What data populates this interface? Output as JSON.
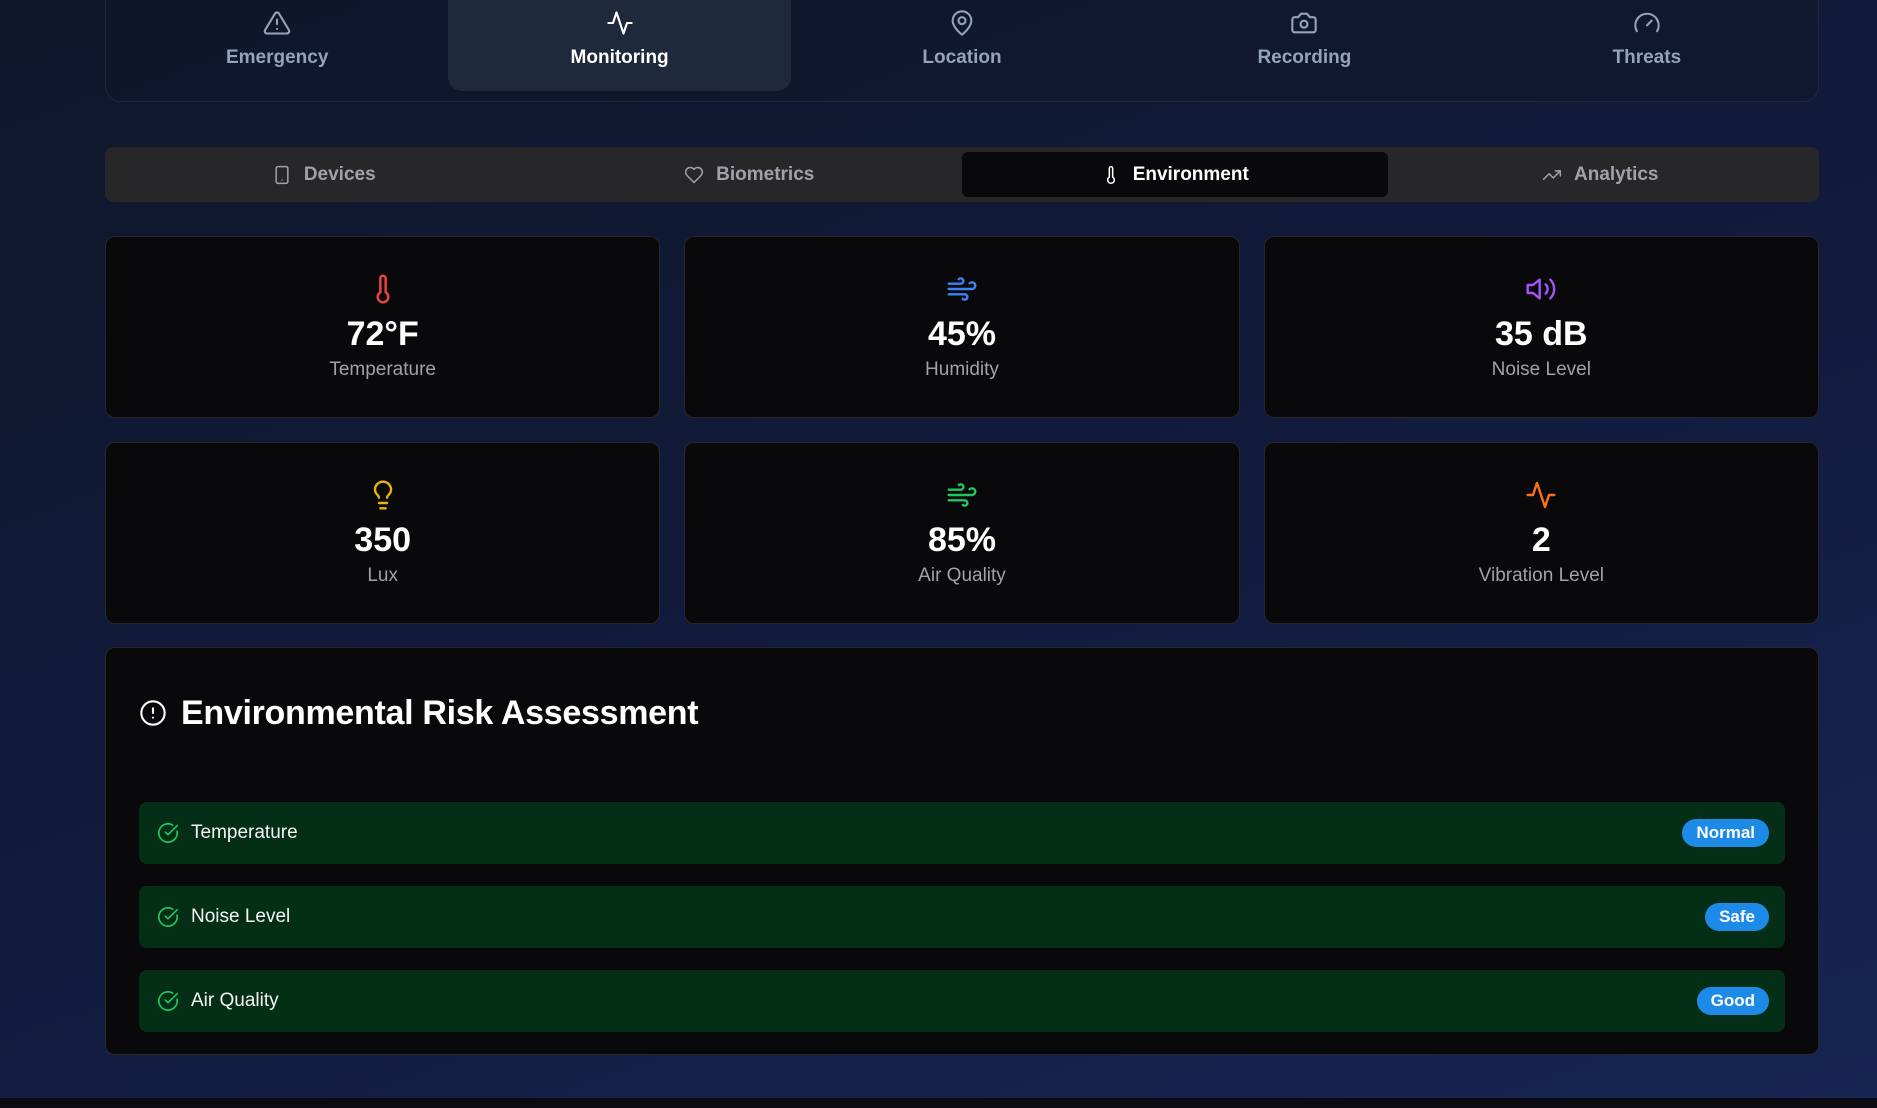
{
  "topnav": {
    "items": [
      {
        "label": "Emergency",
        "icon": "alert-triangle-icon"
      },
      {
        "label": "Monitoring",
        "icon": "activity-icon",
        "active": true
      },
      {
        "label": "Location",
        "icon": "map-pin-icon"
      },
      {
        "label": "Recording",
        "icon": "camera-icon"
      },
      {
        "label": "Threats",
        "icon": "gauge-icon"
      }
    ]
  },
  "subtabs": {
    "items": [
      {
        "label": "Devices",
        "icon": "smartphone-icon"
      },
      {
        "label": "Biometrics",
        "icon": "heart-icon"
      },
      {
        "label": "Environment",
        "icon": "thermometer-icon",
        "active": true
      },
      {
        "label": "Analytics",
        "icon": "trending-up-icon"
      }
    ]
  },
  "metrics": [
    {
      "value": "72°F",
      "label": "Temperature",
      "icon": "thermometer-icon",
      "color": "#ef4444"
    },
    {
      "value": "45%",
      "label": "Humidity",
      "icon": "wind-icon",
      "color": "#3b82f6"
    },
    {
      "value": "35 dB",
      "label": "Noise Level",
      "icon": "volume-icon",
      "color": "#a855f7"
    },
    {
      "value": "350",
      "label": "Lux",
      "icon": "lightbulb-icon",
      "color": "#eab308"
    },
    {
      "value": "85%",
      "label": "Air Quality",
      "icon": "wind-icon",
      "color": "#22c55e"
    },
    {
      "value": "2",
      "label": "Vibration Level",
      "icon": "activity-icon",
      "color": "#f97316"
    }
  ],
  "risk": {
    "title": "Environmental Risk Assessment",
    "icon": "alert-circle-icon",
    "items": [
      {
        "name": "Temperature",
        "status": "Normal"
      },
      {
        "name": "Noise Level",
        "status": "Safe"
      },
      {
        "name": "Air Quality",
        "status": "Good"
      }
    ],
    "check_color": "#22c55e",
    "badge_color": "#1d8ae8"
  }
}
